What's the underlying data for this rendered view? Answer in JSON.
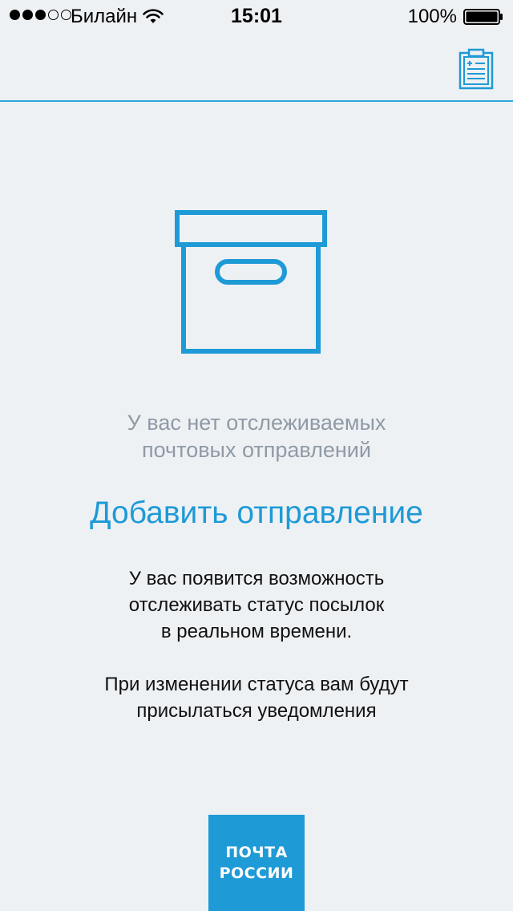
{
  "status_bar": {
    "signal_full": 3,
    "signal_empty": 2,
    "carrier": "Билайн",
    "time": "15:01",
    "battery": "100%"
  },
  "nav": {
    "action_icon": "clipboard-icon"
  },
  "empty_state": {
    "icon": "box-icon",
    "title_line1": "У вас нет отслеживаемых",
    "title_line2": "почтовых отправлений",
    "add_link": "Добавить отправление",
    "info_line1": "У вас появится возможность",
    "info_line2": "отслеживать статус посылок",
    "info_line3": "в реальном времени.",
    "notify_line1": "При изменении статуса вам будут",
    "notify_line2": "присылаться уведомления"
  },
  "logo": {
    "line1": "ПОЧТА",
    "line2": "РОССИИ"
  },
  "colors": {
    "accent": "#1e9ad6",
    "background": "#eef1f4",
    "muted_text": "#8f9aa6"
  }
}
